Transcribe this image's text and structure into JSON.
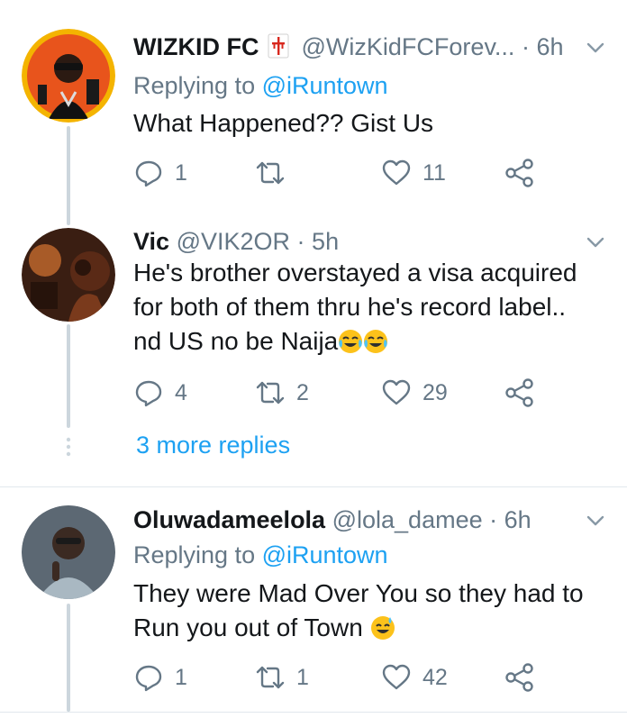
{
  "tweets": [
    {
      "name": "WIZKID FC",
      "handle": "@WizKidFCForev...",
      "dot": "·",
      "time": "6h",
      "replying_prefix": "Replying to ",
      "replying_to": "@iRuntown",
      "text": "What Happened??  Gist Us",
      "replies": "1",
      "retweets": "",
      "likes": "11"
    },
    {
      "name": "Vic",
      "handle": "@VIK2OR",
      "dot": "·",
      "time": "5h",
      "text_lines": [
        "He's brother overstayed a visa acquired",
        "for both of them thru he's record label..",
        "nd US no be Naija"
      ],
      "emoji": [
        "face-with-tears-of-joy",
        "face-with-tears-of-joy"
      ],
      "replies": "4",
      "retweets": "2",
      "likes": "29"
    },
    {
      "name": "Oluwadameelola",
      "handle": "@lola_damee",
      "dot": "·",
      "time": "6h",
      "replying_prefix": "Replying to ",
      "replying_to": "@iRuntown",
      "text_lines": [
        "They were Mad Over You so they had to",
        "Run you out of Town"
      ],
      "emoji": [
        "grinning-face-with-sweat"
      ],
      "replies": "1",
      "retweets": "1",
      "likes": "42"
    }
  ],
  "more_replies": "3 more replies",
  "colors": {
    "link": "#1da1f2",
    "muted": "#657786",
    "text": "#14171a",
    "thread_line": "#ccd6dd",
    "divider": "#e1e8ed"
  }
}
